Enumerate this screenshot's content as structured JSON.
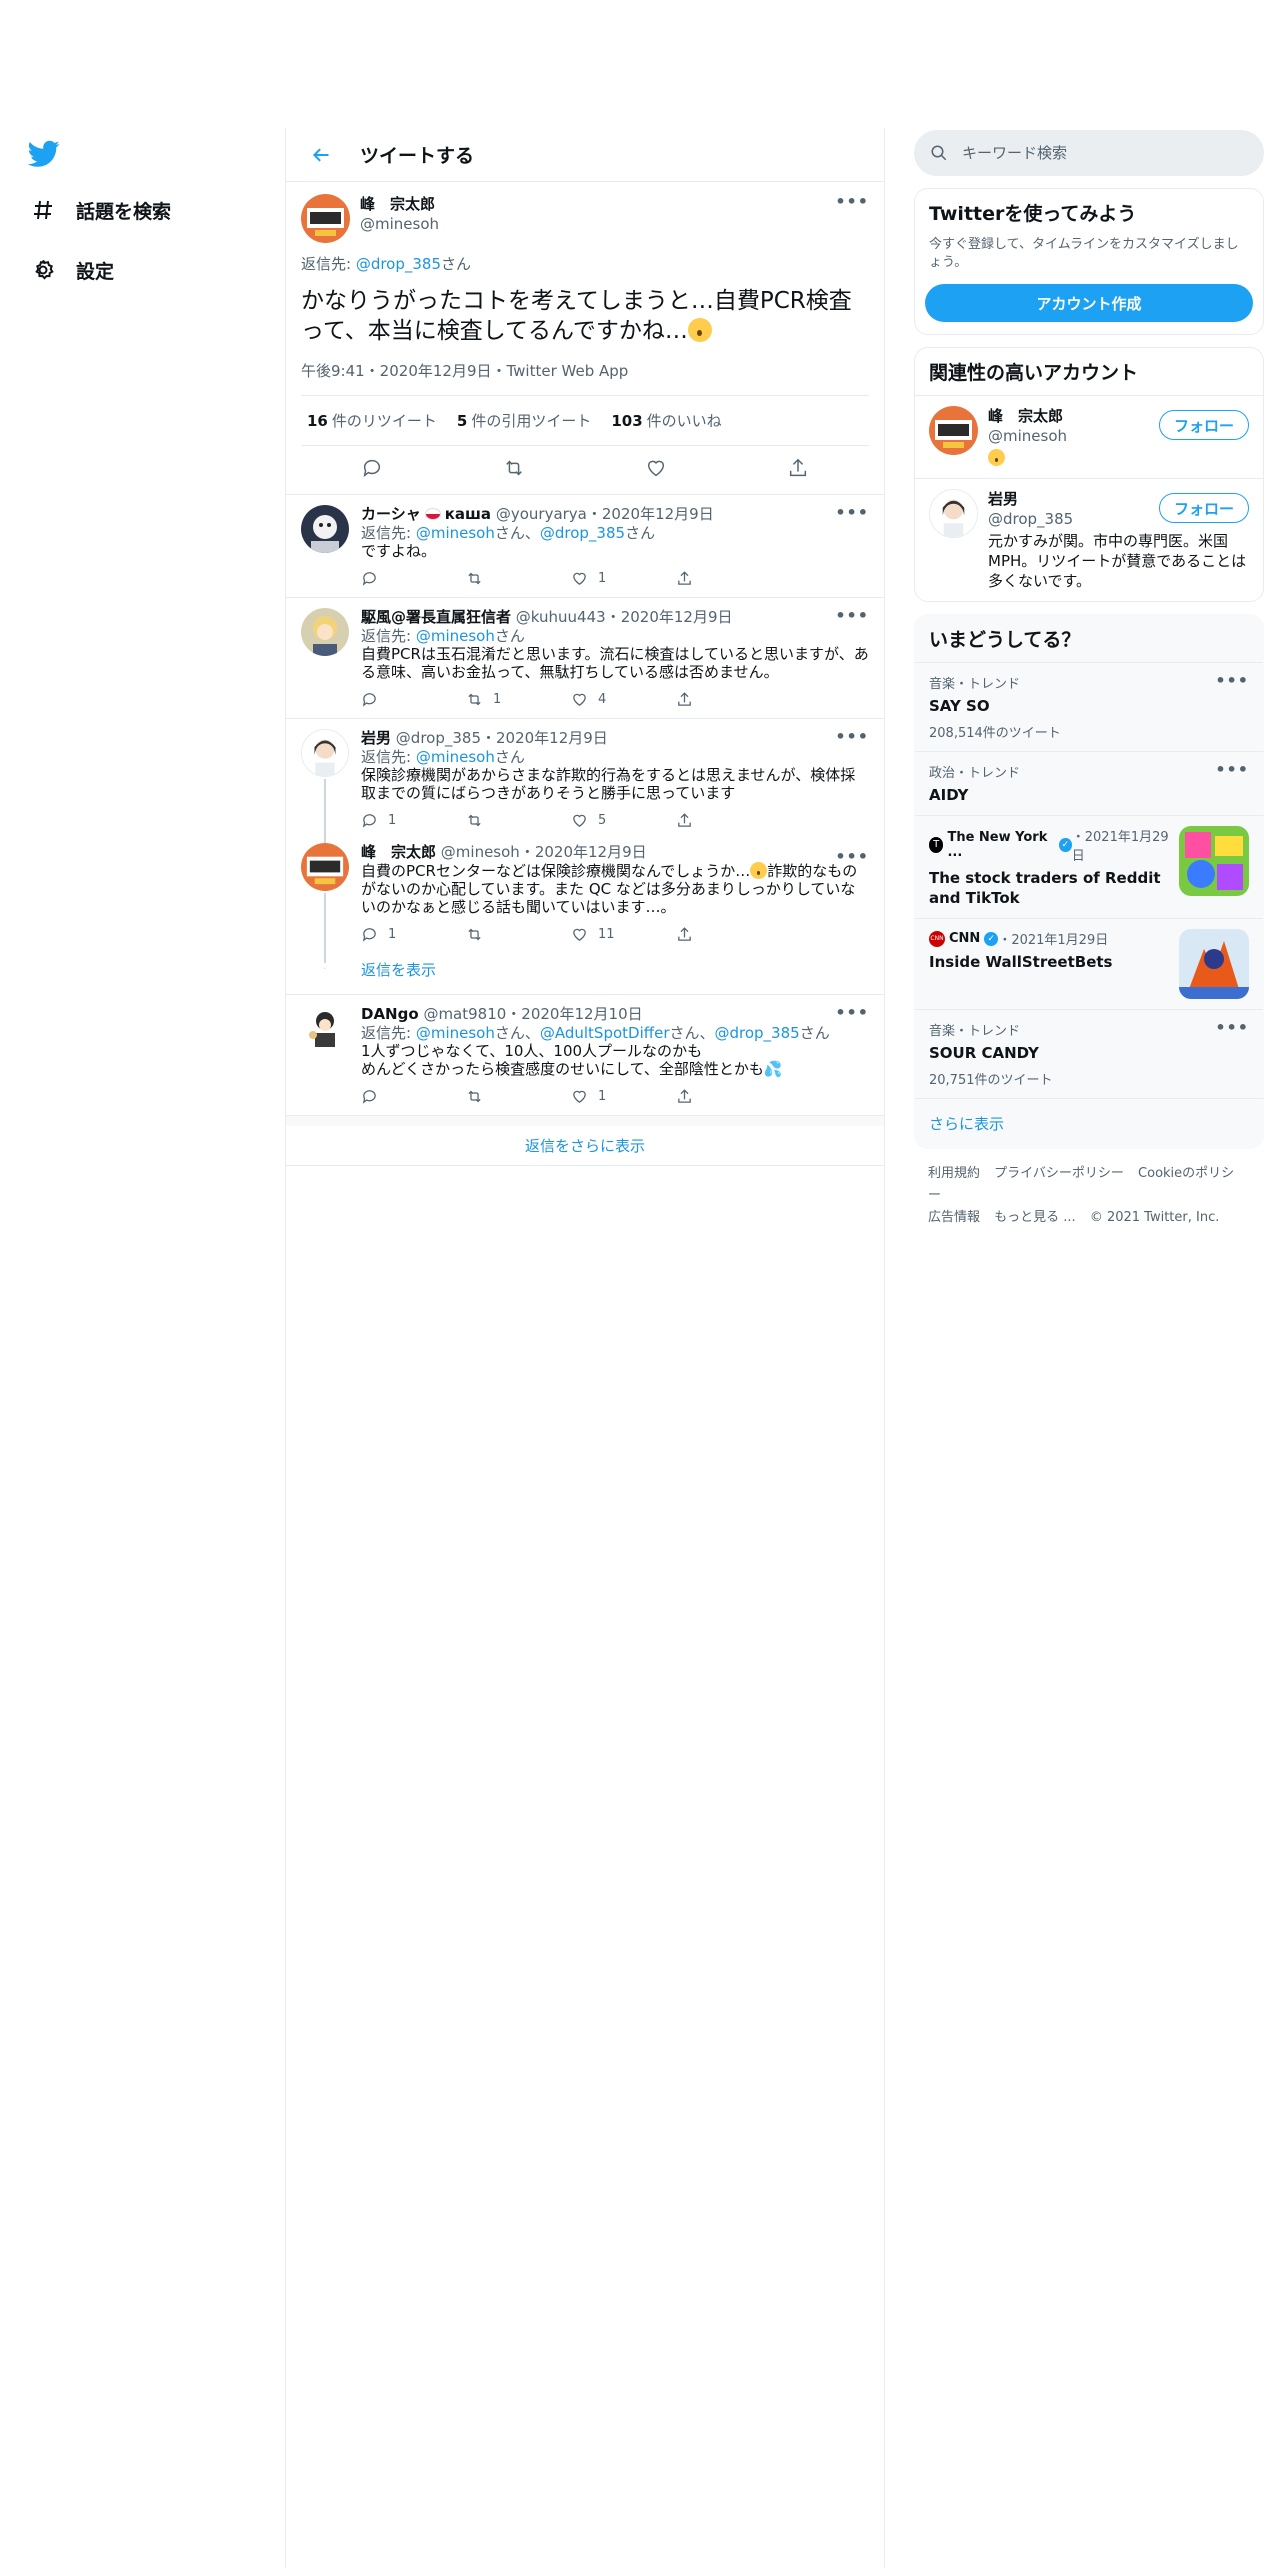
{
  "nav": {
    "search_label": "話題を検索",
    "settings_label": "設定"
  },
  "header": {
    "title": "ツイートする"
  },
  "main_tweet": {
    "name": "峰　宗太郎",
    "handle": "@minesoh",
    "reply_prefix": "返信先: ",
    "reply_to": "@drop_385",
    "reply_suffix": "さん",
    "text": "かなりうがったコトを考えてしまうと…自費PCR検査って、本当に検査してるんですかね…",
    "time": "午後9:41・2020年12月9日・Twitter Web App",
    "retweets": "16",
    "retweets_label": "件のリツイート",
    "quotes": "5",
    "quotes_label": "件の引用ツイート",
    "likes": "103",
    "likes_label": "件のいいね"
  },
  "replies": [
    {
      "name": "カーシャ",
      "name_suffix": "каша",
      "handle": "@youryarya",
      "date": "・2020年12月9日",
      "reply_prefix": "返信先: ",
      "reply_to_1": "@minesoh",
      "reply_sep": "さん、",
      "reply_to_2": "@drop_385",
      "reply_suffix": "さん",
      "text": "ですよね。",
      "retweets": "",
      "likes": "1"
    },
    {
      "name": "駆風@署長直属狂信者",
      "handle": "@kuhuu443",
      "date": "・2020年12月9日",
      "reply_prefix": "返信先: ",
      "reply_to_1": "@minesoh",
      "reply_suffix": "さん",
      "text": "自費PCRは玉石混淆だと思います。流石に検査はしていると思いますが、ある意味、高いお金払って、無駄打ちしている感は否めません。",
      "retweets": "1",
      "likes": "4"
    },
    {
      "name": "岩男",
      "handle": "@drop_385",
      "date": "・2020年12月9日",
      "reply_prefix": "返信先: ",
      "reply_to_1": "@minesoh",
      "reply_suffix": "さん",
      "text": "保険診療機関があからさまな詐欺的行為をするとは思えませんが、検体採取までの質にばらつきがありそうと勝手に思っています",
      "replies": "1",
      "likes": "5"
    },
    {
      "name": "峰　宗太郎",
      "handle": "@minesoh",
      "date": "・2020年12月9日",
      "text_a": "自費のPCRセンターなどは保険診療機関なんでしょうか…",
      "text_b": "詐欺的なものがないのか心配しています。また QC などは多分あまりしっかりしていないのかなぁと感じる話も聞いていはいます…。",
      "replies": "1",
      "likes": "11"
    },
    {
      "name": "DANgo",
      "handle": "@mat9810",
      "date": "・2020年12月10日",
      "reply_prefix": "返信先: ",
      "reply_to_1": "@minesoh",
      "reply_sep_1": "さん、",
      "reply_to_2": "@AdultSpotDiffer",
      "reply_sep_2": "さん、",
      "reply_to_3": "@drop_385",
      "reply_suffix": "さん",
      "text_1": "1人ずつじゃなくて、10人、100人プールなのかも",
      "text_2": "めんどくさかったら検査感度のせいにして、全部陰性とかも",
      "likes": "1"
    }
  ],
  "show_replies": "返信を表示",
  "show_more_replies": "返信をさらに表示",
  "sidebar": {
    "search_placeholder": "キーワード検索",
    "signup": {
      "title": "Twitterを使ってみよう",
      "desc": "今すぐ登録して、タイムラインをカスタマイズしましょう。",
      "button": "アカウント作成"
    },
    "related": {
      "title": "関連性の高いアカウント",
      "follow_label": "フォロー",
      "accounts": [
        {
          "name": "峰　宗太郎",
          "handle": "@minesoh",
          "bio": ""
        },
        {
          "name": "岩男",
          "handle": "@drop_385",
          "bio": "元かすみが関。市中の専門医。米国MPH。リツイートが賛意であることは多くないです。"
        }
      ]
    },
    "trends": {
      "title": "いまどうしてる？",
      "items": [
        {
          "category": "音楽・トレンド",
          "title": "SAY SO",
          "count": "208,514件のツイート"
        },
        {
          "category": "政治・トレンド",
          "title": "AIDY",
          "count": ""
        },
        {
          "source": "The New York ...",
          "date": "・2021年1月29日",
          "title": "The stock traders of Reddit and TikTok"
        },
        {
          "source": "CNN",
          "date": "・2021年1月29日",
          "title": "Inside WallStreetBets"
        },
        {
          "category": "音楽・トレンド",
          "title": "SOUR CANDY",
          "count": "20,751件のツイート"
        }
      ],
      "show_more": "さらに表示"
    },
    "footer": {
      "terms": "利用規約",
      "privacy": "プライバシーポリシー",
      "cookie": "Cookieのポリシー",
      "ads": "広告情報",
      "more": "もっと見る ...",
      "copyright": "© 2021 Twitter, Inc."
    }
  }
}
